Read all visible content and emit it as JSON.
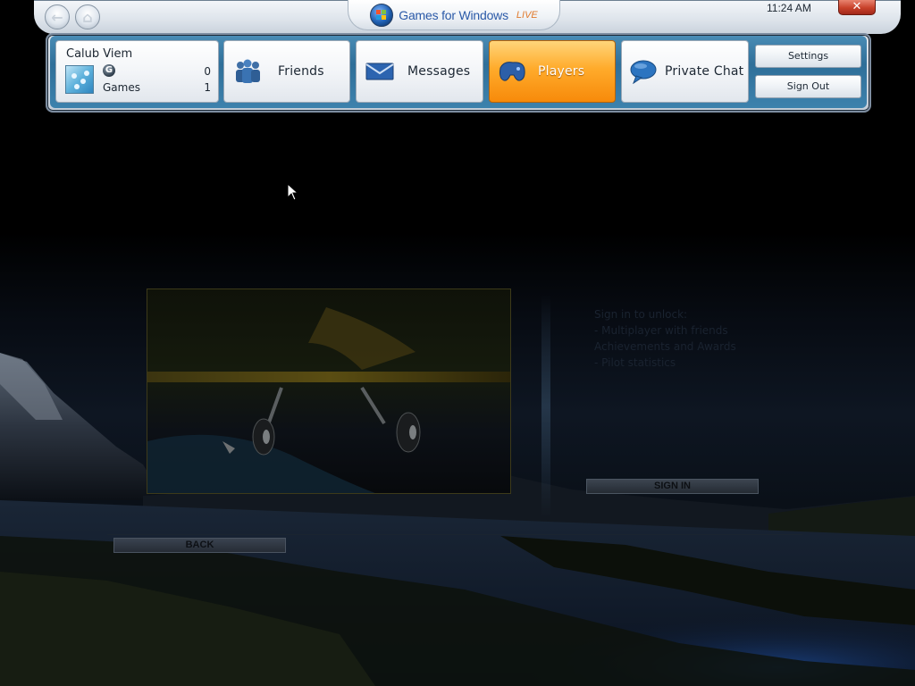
{
  "title_bar": {
    "logo_text": "Games for Windows",
    "logo_live": "LIVE",
    "clock": "11:24 AM",
    "close_label": "✕",
    "back_icon": "back-arrow-icon",
    "home_icon": "home-icon"
  },
  "profile": {
    "name": "Calub Viem",
    "gamerscore_icon": "G",
    "gamerscore": "0",
    "games_label": "Games",
    "games_count": "1"
  },
  "tabs": {
    "friends": "Friends",
    "messages": "Messages",
    "players": "Players",
    "private_chat": "Private Chat"
  },
  "side_buttons": {
    "settings": "Settings",
    "sign_out": "Sign Out"
  },
  "game": {
    "features": [
      "Sign in to unlock:",
      "- Multiplayer with friends",
      "  Achievements and Awards",
      "- Pilot statistics"
    ],
    "sign_in_label": "SIGN IN",
    "back_label": "BACK"
  },
  "colors": {
    "players_accent": "#f78a0a",
    "close_red": "#c8412a",
    "panel_blue": "#2f6f99"
  }
}
